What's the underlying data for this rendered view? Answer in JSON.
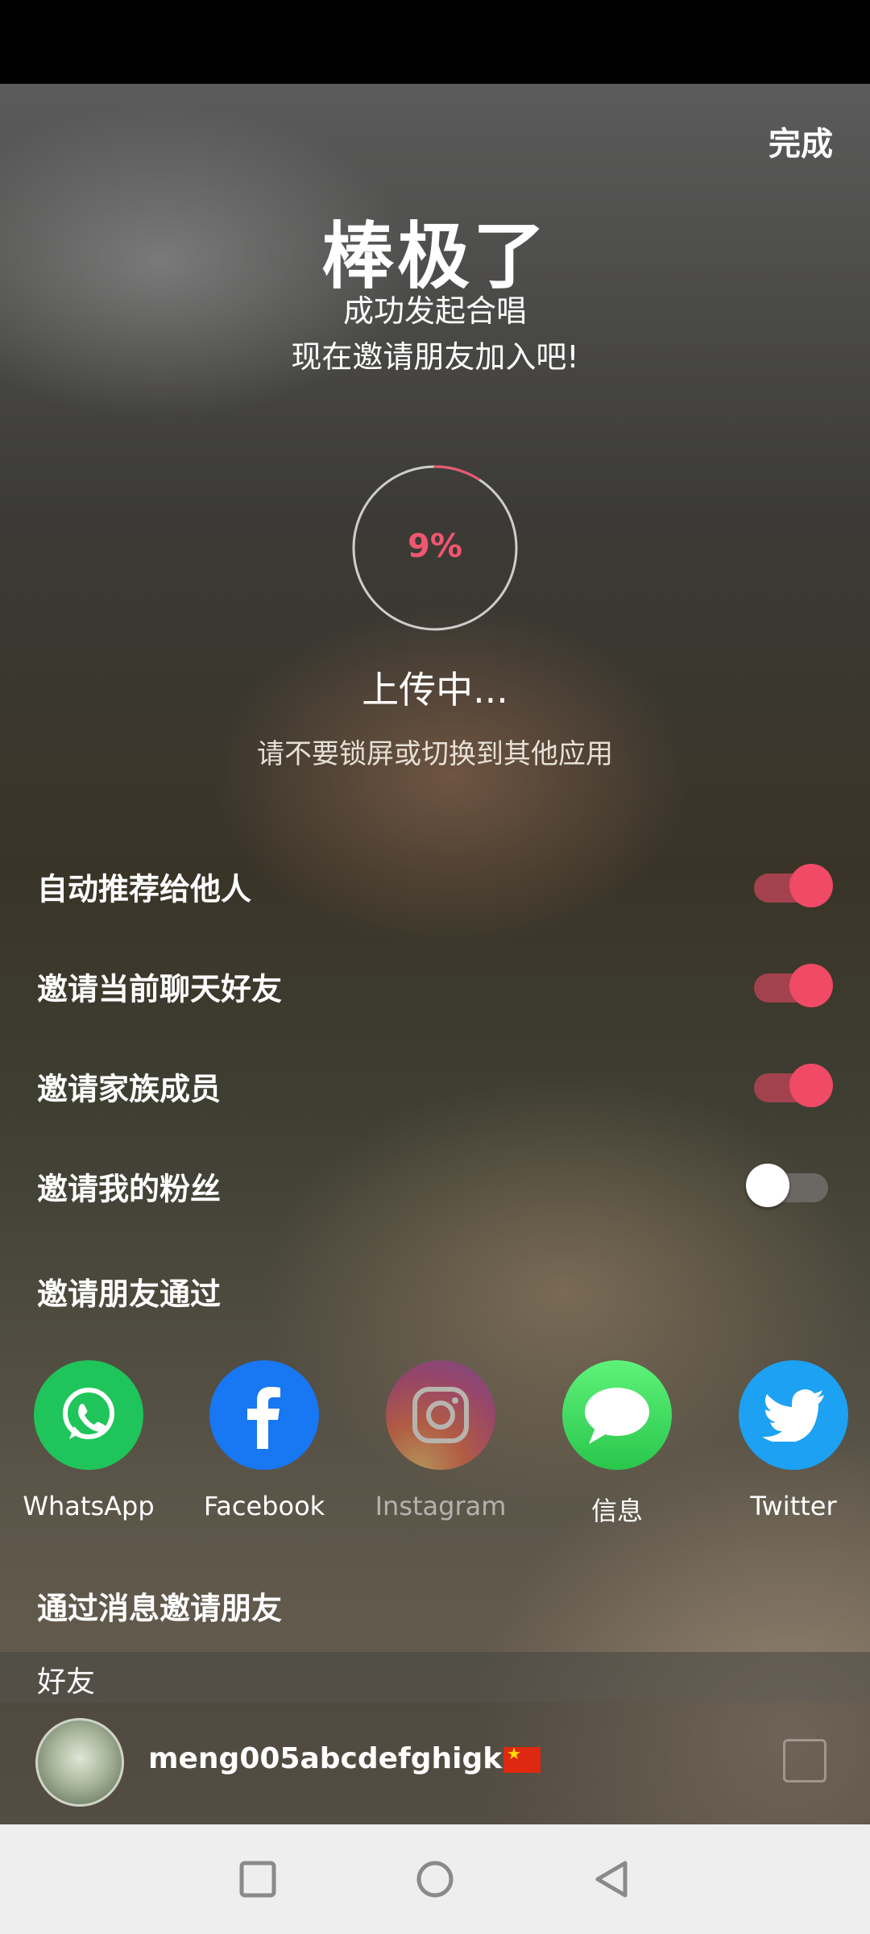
{
  "header": {
    "done_label": "完成"
  },
  "hero": {
    "title": "棒极了",
    "subtitle_line1": "成功发起合唱",
    "subtitle_line2": "现在邀请朋友加入吧!"
  },
  "upload": {
    "progress_percent": 9,
    "progress_text": "9%",
    "status": "上传中...",
    "warning": "请不要锁屏或切换到其他应用"
  },
  "toggles": [
    {
      "label": "自动推荐给他人",
      "on": true
    },
    {
      "label": "邀请当前聊天好友",
      "on": true
    },
    {
      "label": "邀请家族成员",
      "on": true
    },
    {
      "label": "邀请我的粉丝",
      "on": false
    }
  ],
  "invite_section": {
    "title": "邀请朋友通过"
  },
  "share_apps": [
    {
      "name": "WhatsApp",
      "icon": "whatsapp-icon",
      "color": "#1fc55a"
    },
    {
      "name": "Facebook",
      "icon": "facebook-icon",
      "color": "#1877f2"
    },
    {
      "name": "Instagram",
      "icon": "instagram-icon",
      "color": "#c13584"
    },
    {
      "name": "信息",
      "icon": "message-icon",
      "color": "#34c759"
    },
    {
      "name": "Twitter",
      "icon": "twitter-icon",
      "color": "#1da1f2"
    }
  ],
  "message_section": {
    "title": "通过消息邀请朋友"
  },
  "friends": {
    "header": "好友",
    "items": [
      {
        "name": "meng005abcdefghigk",
        "country_flag": "CN",
        "checked": false
      }
    ]
  },
  "colors": {
    "accent": "#f04a67",
    "toggle_track_on": "#a3424f",
    "progress_text": "#f0566f"
  }
}
